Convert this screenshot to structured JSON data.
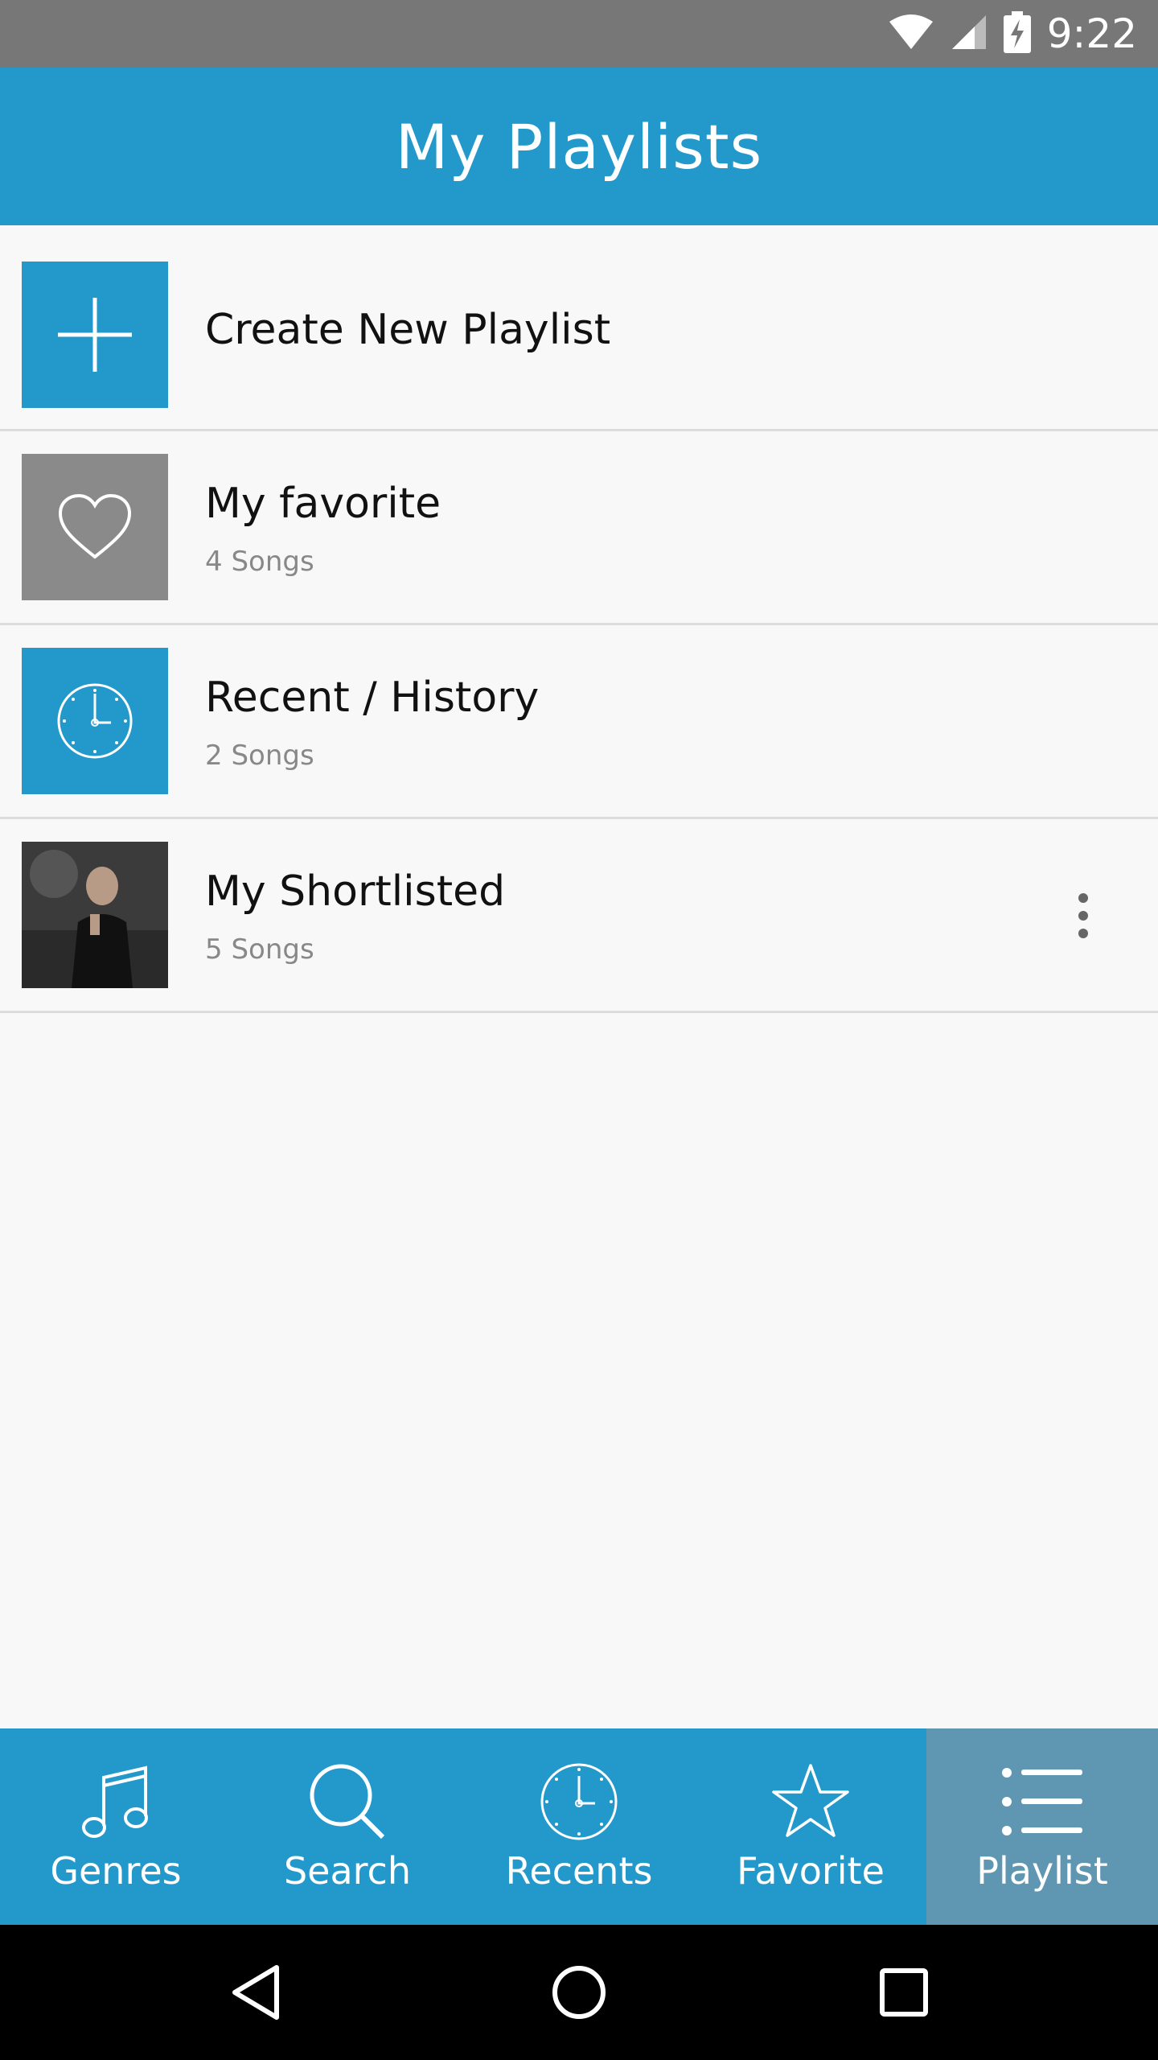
{
  "status_bar": {
    "time": "9:22",
    "icons": [
      "wifi-icon",
      "signal-icon",
      "battery-charging-icon"
    ]
  },
  "app_bar": {
    "title": "My Playlists"
  },
  "playlists": [
    {
      "title": "Create New Playlist",
      "subtitle": "",
      "icon": "plus-icon"
    },
    {
      "title": "My favorite",
      "subtitle": "4 Songs",
      "icon": "heart-icon"
    },
    {
      "title": "Recent / History",
      "subtitle": "2 Songs",
      "icon": "clock-icon"
    },
    {
      "title": "My Shortlisted",
      "subtitle": "5 Songs",
      "icon": "photo-thumbnail"
    }
  ],
  "bottom_nav": {
    "items": [
      {
        "label": "Genres",
        "icon": "music-note-icon"
      },
      {
        "label": "Search",
        "icon": "search-icon"
      },
      {
        "label": "Recents",
        "icon": "clock-icon"
      },
      {
        "label": "Favorite",
        "icon": "star-icon"
      },
      {
        "label": "Playlist",
        "icon": "list-icon"
      }
    ],
    "active": "Playlist"
  },
  "colors": {
    "primary": "#2399cb",
    "active_tab": "#5f96b2",
    "status_bar": "#777777",
    "background": "#f9f8f8"
  }
}
